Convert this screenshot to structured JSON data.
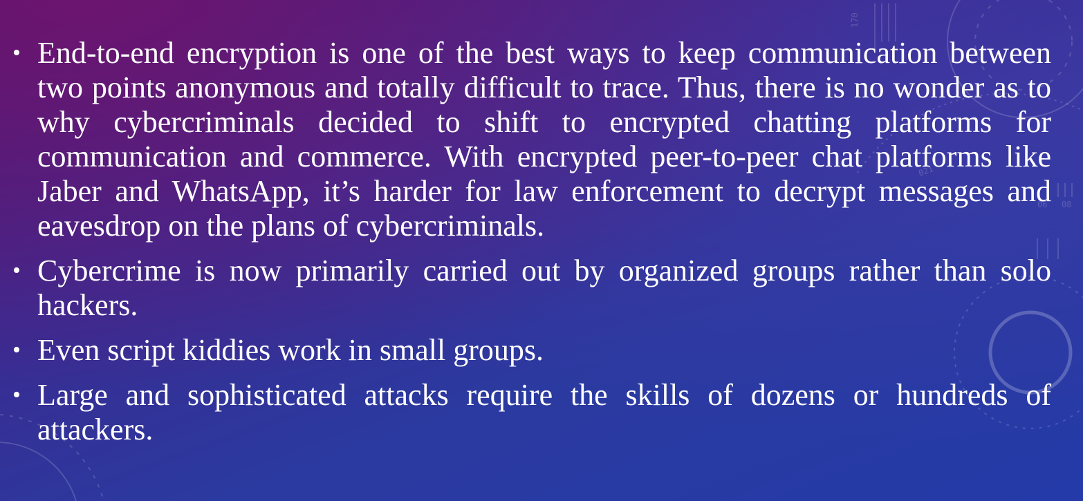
{
  "slide": {
    "background_colors": [
      "#4a1570",
      "#3a2a90",
      "#243aa8"
    ],
    "decoration": {
      "dial_ticks_labels": [
        "170",
        "08",
        "06",
        "021"
      ]
    },
    "bullets": [
      {
        "text": "End-to-end encryption is one of the best ways to keep communication between two points anonymous and totally difficult to trace. Thus, there is no wonder as to why cybercriminals decided to shift to encrypted chatting platforms for communication and commerce. With encrypted peer-to-peer chat platforms like Jaber and WhatsApp, it’s harder for law enforcement to decrypt messages and eavesdrop on the plans of cybercriminals."
      },
      {
        "text": "Cybercrime is now primarily carried out by organized groups rather than solo hackers."
      },
      {
        "text": "Even script kiddies work in small groups."
      },
      {
        "text": "Large and sophisticated attacks require the skills of dozens or hundreds of attackers."
      }
    ]
  }
}
